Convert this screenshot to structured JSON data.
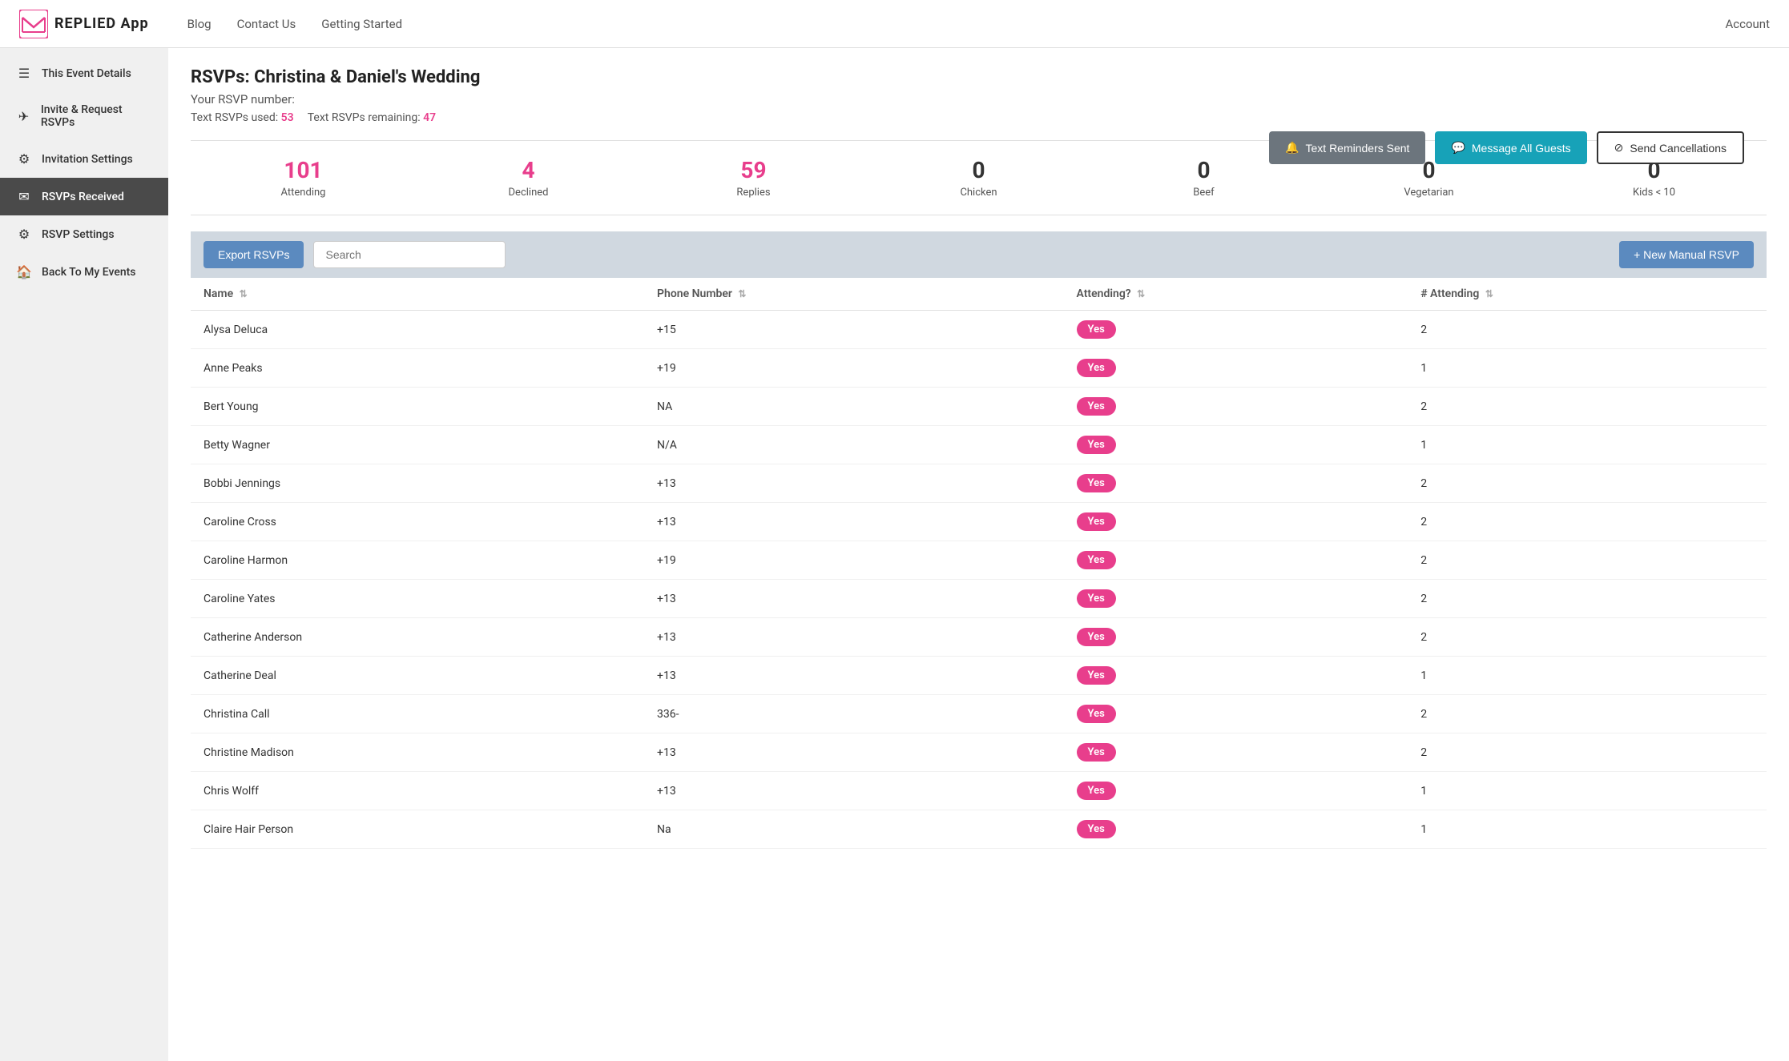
{
  "topNav": {
    "logo": "REPLIED App",
    "links": [
      "Blog",
      "Contact Us",
      "Getting Started"
    ],
    "account": "Account"
  },
  "sidebar": {
    "items": [
      {
        "id": "this-event-details",
        "label": "This Event Details",
        "icon": "☰",
        "active": false
      },
      {
        "id": "invite-request-rsvps",
        "label": "Invite & Request RSVPs",
        "icon": "✈",
        "active": false
      },
      {
        "id": "invitation-settings",
        "label": "Invitation Settings",
        "icon": "⚙",
        "active": false
      },
      {
        "id": "rsvps-received",
        "label": "RSVPs Received",
        "icon": "✉",
        "active": true
      },
      {
        "id": "rsvp-settings",
        "label": "RSVP Settings",
        "icon": "⚙",
        "active": false
      },
      {
        "id": "back-to-my-events",
        "label": "Back To My Events",
        "icon": "🏠",
        "active": false
      }
    ]
  },
  "pageTitle": "RSVPs: Christina & Daniel's Wedding",
  "rsvpNumberLabel": "Your RSVP number:",
  "textRsvpsUsed": "53",
  "textRsvpsRemaining": "47",
  "textRsvpsUsedLabel": "Text RSVPs used:",
  "textRsvpsRemainingLabel": "Text RSVPs remaining:",
  "buttons": {
    "textReminders": "Text Reminders Sent",
    "messageAll": "Message All Guests",
    "sendCancellations": "Send Cancellations",
    "exportRsvps": "Export RSVPs",
    "newManualRsvp": "+ New Manual RSVP"
  },
  "searchPlaceholder": "Search",
  "stats": [
    {
      "value": "101",
      "label": "Attending",
      "pink": true
    },
    {
      "value": "4",
      "label": "Declined",
      "pink": true
    },
    {
      "value": "59",
      "label": "Replies",
      "pink": true
    },
    {
      "value": "0",
      "label": "Chicken",
      "pink": false
    },
    {
      "value": "0",
      "label": "Beef",
      "pink": false
    },
    {
      "value": "0",
      "label": "Vegetarian",
      "pink": false
    },
    {
      "value": "0",
      "label": "Kids < 10",
      "pink": false
    }
  ],
  "tableColumns": [
    {
      "label": "Name",
      "sortable": true
    },
    {
      "label": "Phone Number",
      "sortable": true
    },
    {
      "label": "Attending?",
      "sortable": true
    },
    {
      "label": "# Attending",
      "sortable": true
    }
  ],
  "tableRows": [
    {
      "name": "Alysa Deluca",
      "phone": "+15",
      "attending": "Yes",
      "count": "2"
    },
    {
      "name": "Anne Peaks",
      "phone": "+19",
      "attending": "Yes",
      "count": "1"
    },
    {
      "name": "Bert Young",
      "phone": "NA",
      "attending": "Yes",
      "count": "2"
    },
    {
      "name": "Betty Wagner",
      "phone": "N/A",
      "attending": "Yes",
      "count": "1"
    },
    {
      "name": "Bobbi Jennings",
      "phone": "+13",
      "attending": "Yes",
      "count": "2"
    },
    {
      "name": "Caroline Cross",
      "phone": "+13",
      "attending": "Yes",
      "count": "2"
    },
    {
      "name": "Caroline Harmon",
      "phone": "+19",
      "attending": "Yes",
      "count": "2"
    },
    {
      "name": "Caroline Yates",
      "phone": "+13",
      "attending": "Yes",
      "count": "2"
    },
    {
      "name": "Catherine Anderson",
      "phone": "+13",
      "attending": "Yes",
      "count": "2"
    },
    {
      "name": "Catherine Deal",
      "phone": "+13",
      "attending": "Yes",
      "count": "1"
    },
    {
      "name": "Christina Call",
      "phone": "336-",
      "attending": "Yes",
      "count": "2"
    },
    {
      "name": "Christine Madison",
      "phone": "+13",
      "attending": "Yes",
      "count": "2"
    },
    {
      "name": "Chris Wolff",
      "phone": "+13",
      "attending": "Yes",
      "count": "1"
    },
    {
      "name": "Claire Hair Person",
      "phone": "Na",
      "attending": "Yes",
      "count": "1"
    }
  ]
}
